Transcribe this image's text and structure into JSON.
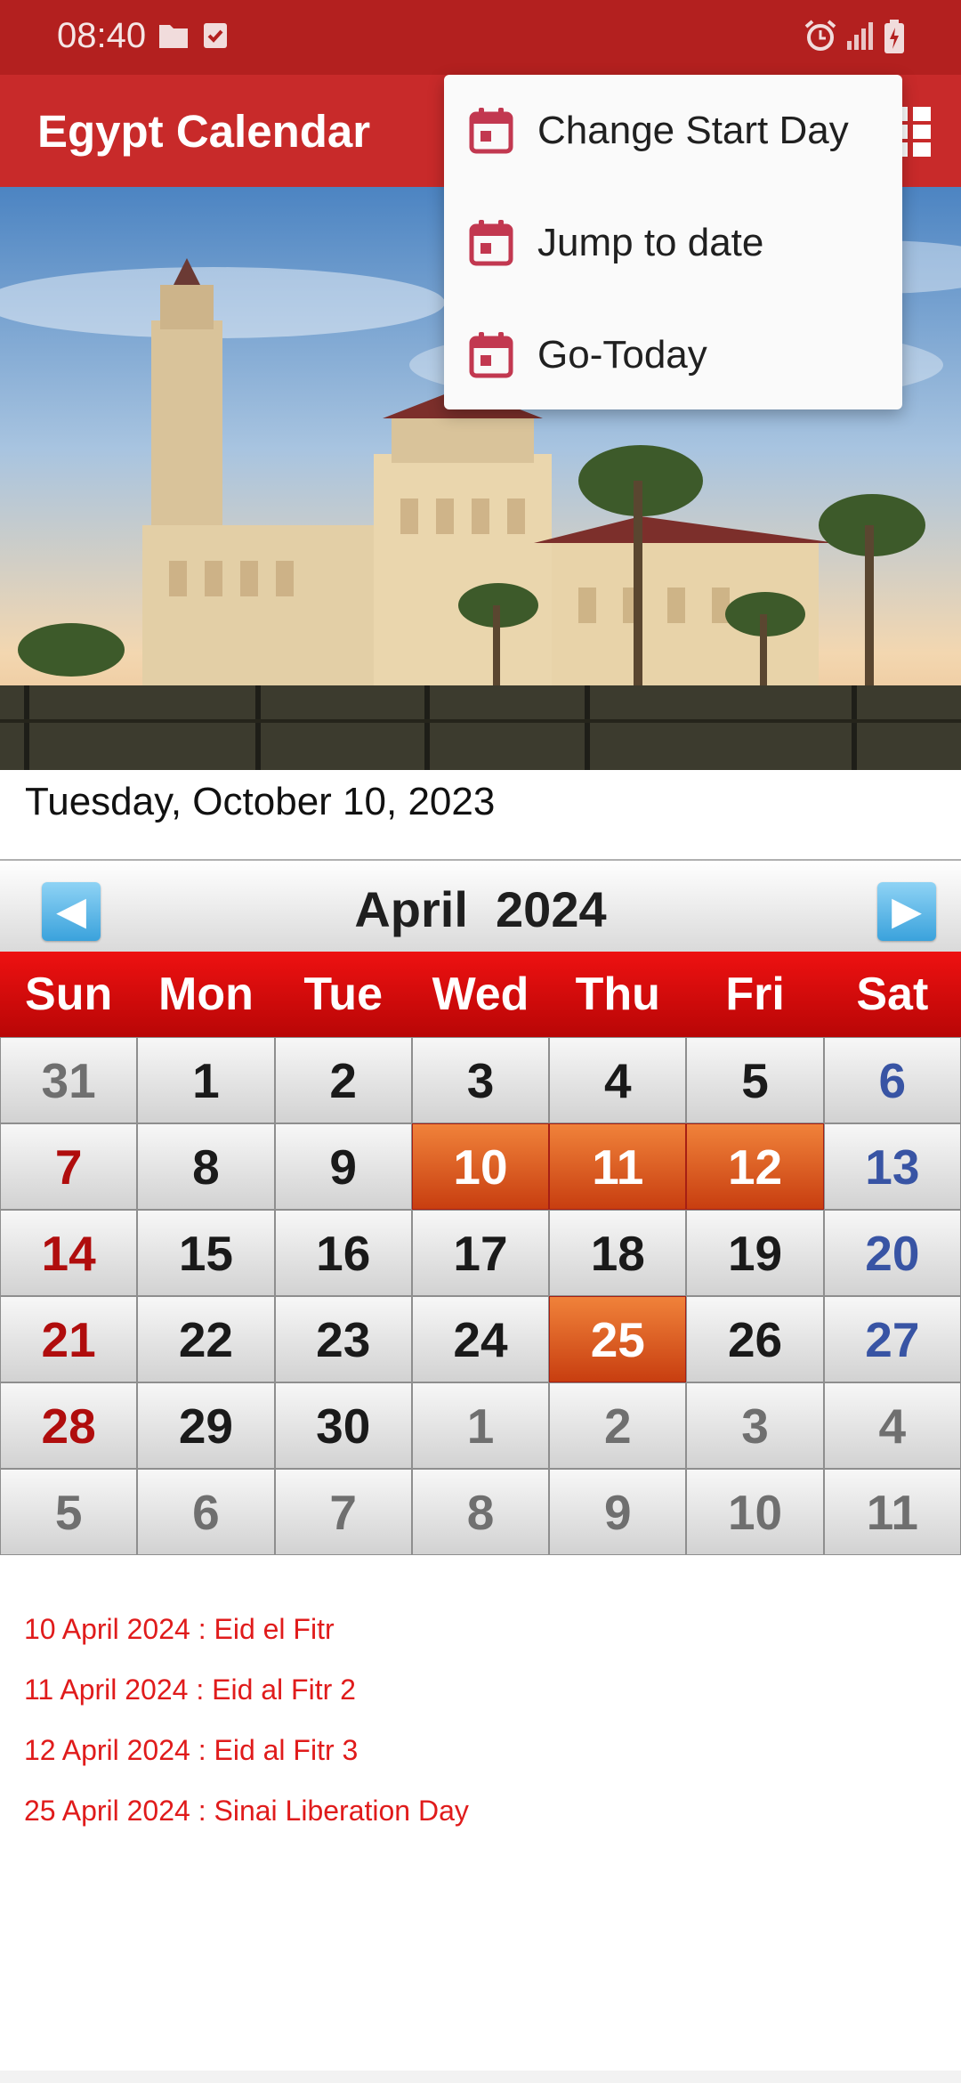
{
  "status_bar": {
    "time": "08:40",
    "left_icons": [
      "folder-icon",
      "checkbox-icon"
    ],
    "right_icons": [
      "alarm-icon",
      "signal-icon",
      "battery-icon"
    ]
  },
  "app_bar": {
    "title": "Egypt Calendar",
    "menu_icon": "grid-icon"
  },
  "overflow_menu": {
    "items": [
      {
        "label": "Change Start Day",
        "icon": "calendar-icon"
      },
      {
        "label": "Jump to date",
        "icon": "calendar-icon"
      },
      {
        "label": "Go-Today",
        "icon": "calendar-icon"
      }
    ]
  },
  "today": "Tuesday, October 10, 2023",
  "calendar": {
    "month_title": "April  2024",
    "prev_icon": "arrow-left-icon",
    "next_icon": "arrow-right-icon",
    "weekdays": [
      "Sun",
      "Mon",
      "Tue",
      "Wed",
      "Thu",
      "Fri",
      "Sat"
    ],
    "days": [
      "31",
      "1",
      "2",
      "3",
      "4",
      "5",
      "6",
      "7",
      "8",
      "9",
      "10",
      "11",
      "12",
      "13",
      "14",
      "15",
      "16",
      "17",
      "18",
      "19",
      "20",
      "21",
      "22",
      "23",
      "24",
      "25",
      "26",
      "27",
      "28",
      "29",
      "30",
      "1",
      "2",
      "3",
      "4",
      "5",
      "6",
      "7",
      "8",
      "9",
      "10",
      "11"
    ]
  },
  "events": [
    "10 April 2024 : Eid el Fitr",
    "11 April 2024 : Eid al Fitr 2",
    "12 April 2024 : Eid al Fitr 3",
    "25 April 2024 : Sinai Liberation Day"
  ],
  "colors": {
    "status_bar": "#b3201f",
    "app_bar": "#c82a2a",
    "holiday": "#d9541e",
    "sunday": "#b00d0d",
    "saturday": "#3854a4",
    "event_text": "#e01b1b"
  }
}
